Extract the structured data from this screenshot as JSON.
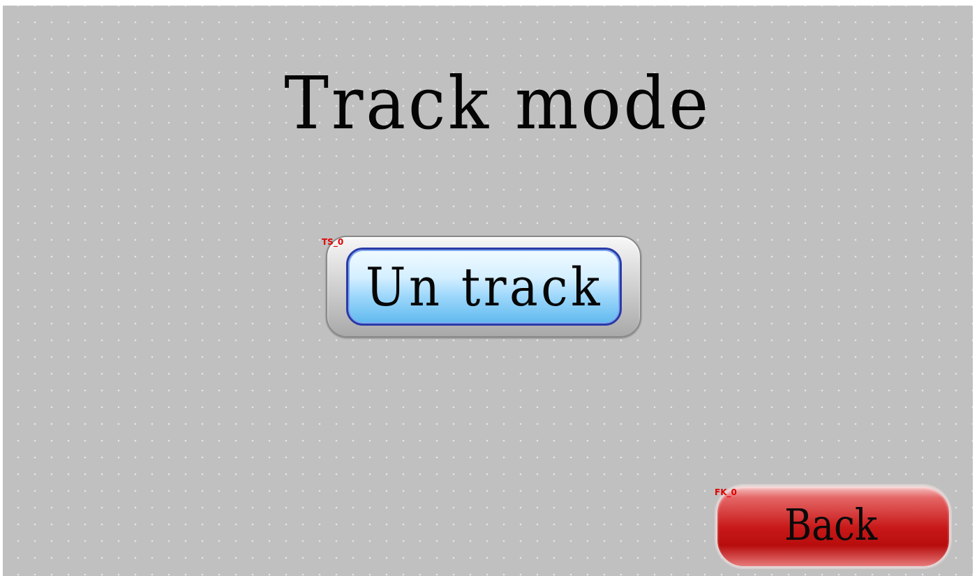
{
  "screen": {
    "title": "Track mode",
    "background_color": "#c0c0c0"
  },
  "untrack_button": {
    "tag": "TS_0",
    "label": "Un track",
    "color": "#9fd8fb"
  },
  "back_button": {
    "tag": "FK_0",
    "label": "Back",
    "color": "#c81818"
  }
}
